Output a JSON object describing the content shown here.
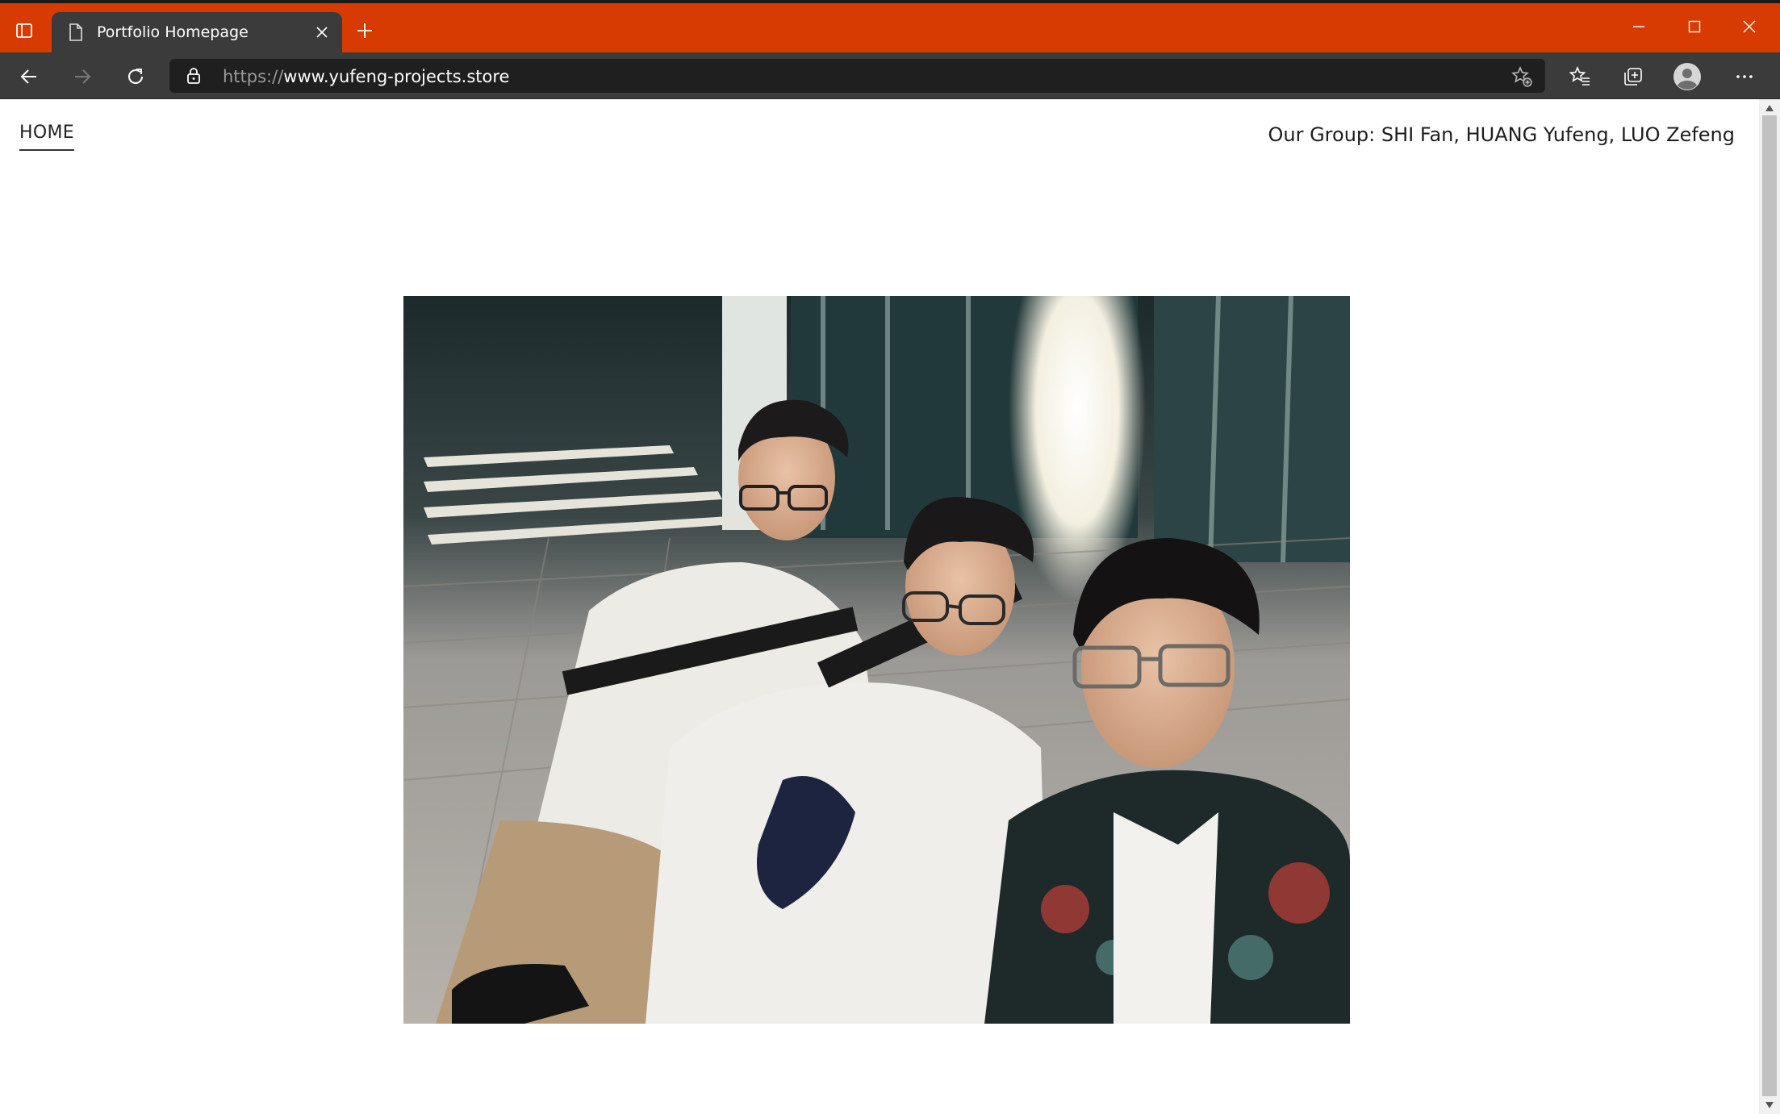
{
  "browser": {
    "tab_title": "Portfolio Homepage",
    "url_protocol": "https://",
    "url_host": "www.yufeng-projects.store",
    "accent_color": "#d83b01",
    "icons": {
      "tab_actions": "tab-actions-icon",
      "page": "page-icon",
      "close_tab": "close-icon",
      "new_tab": "plus-icon",
      "minimize": "minimize-icon",
      "maximize": "maximize-icon",
      "close_window": "close-icon",
      "back": "arrow-left-icon",
      "forward": "arrow-right-icon",
      "refresh": "refresh-icon",
      "lock": "lock-icon",
      "add_favorite": "star-plus-icon",
      "favorites": "favorites-icon",
      "collections": "collections-icon",
      "profile": "profile-icon",
      "more": "more-icon"
    }
  },
  "page": {
    "nav_home": "HOME",
    "group": "Our Group: SHI Fan, HUANG Yufeng, LUO Zefeng",
    "photo_alt": "group-photo"
  }
}
